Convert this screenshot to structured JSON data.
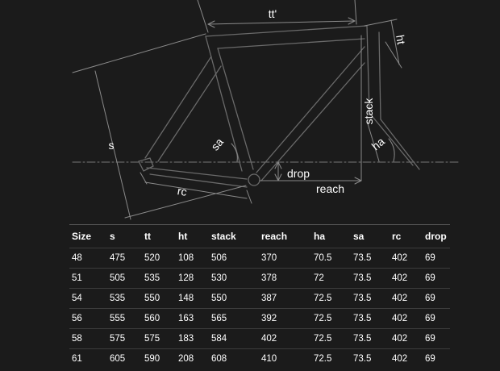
{
  "diagram": {
    "labels": {
      "top_tube": "tt'",
      "head_tube": "ht",
      "stack": "stack",
      "seat_tube": "s",
      "seat_angle": "sa",
      "head_angle": "ha",
      "drop": "drop",
      "reach": "reach",
      "rear_center": "rc"
    },
    "colors": {
      "background": "#1b1b1b",
      "frame_outline": "#6a6a6a",
      "dimension_line": "#8a8a8a",
      "text": "#ffffff"
    }
  },
  "table": {
    "headers": [
      "Size",
      "s",
      "tt",
      "ht",
      "stack",
      "reach",
      "ha",
      "sa",
      "rc",
      "drop"
    ],
    "rows": [
      [
        "48",
        "475",
        "520",
        "108",
        "506",
        "370",
        "70.5",
        "73.5",
        "402",
        "69"
      ],
      [
        "51",
        "505",
        "535",
        "128",
        "530",
        "378",
        "72",
        "73.5",
        "402",
        "69"
      ],
      [
        "54",
        "535",
        "550",
        "148",
        "550",
        "387",
        "72.5",
        "73.5",
        "402",
        "69"
      ],
      [
        "56",
        "555",
        "560",
        "163",
        "565",
        "392",
        "72.5",
        "73.5",
        "402",
        "69"
      ],
      [
        "58",
        "575",
        "575",
        "183",
        "584",
        "402",
        "72.5",
        "73.5",
        "402",
        "69"
      ],
      [
        "61",
        "605",
        "590",
        "208",
        "608",
        "410",
        "72.5",
        "73.5",
        "402",
        "69"
      ]
    ]
  }
}
